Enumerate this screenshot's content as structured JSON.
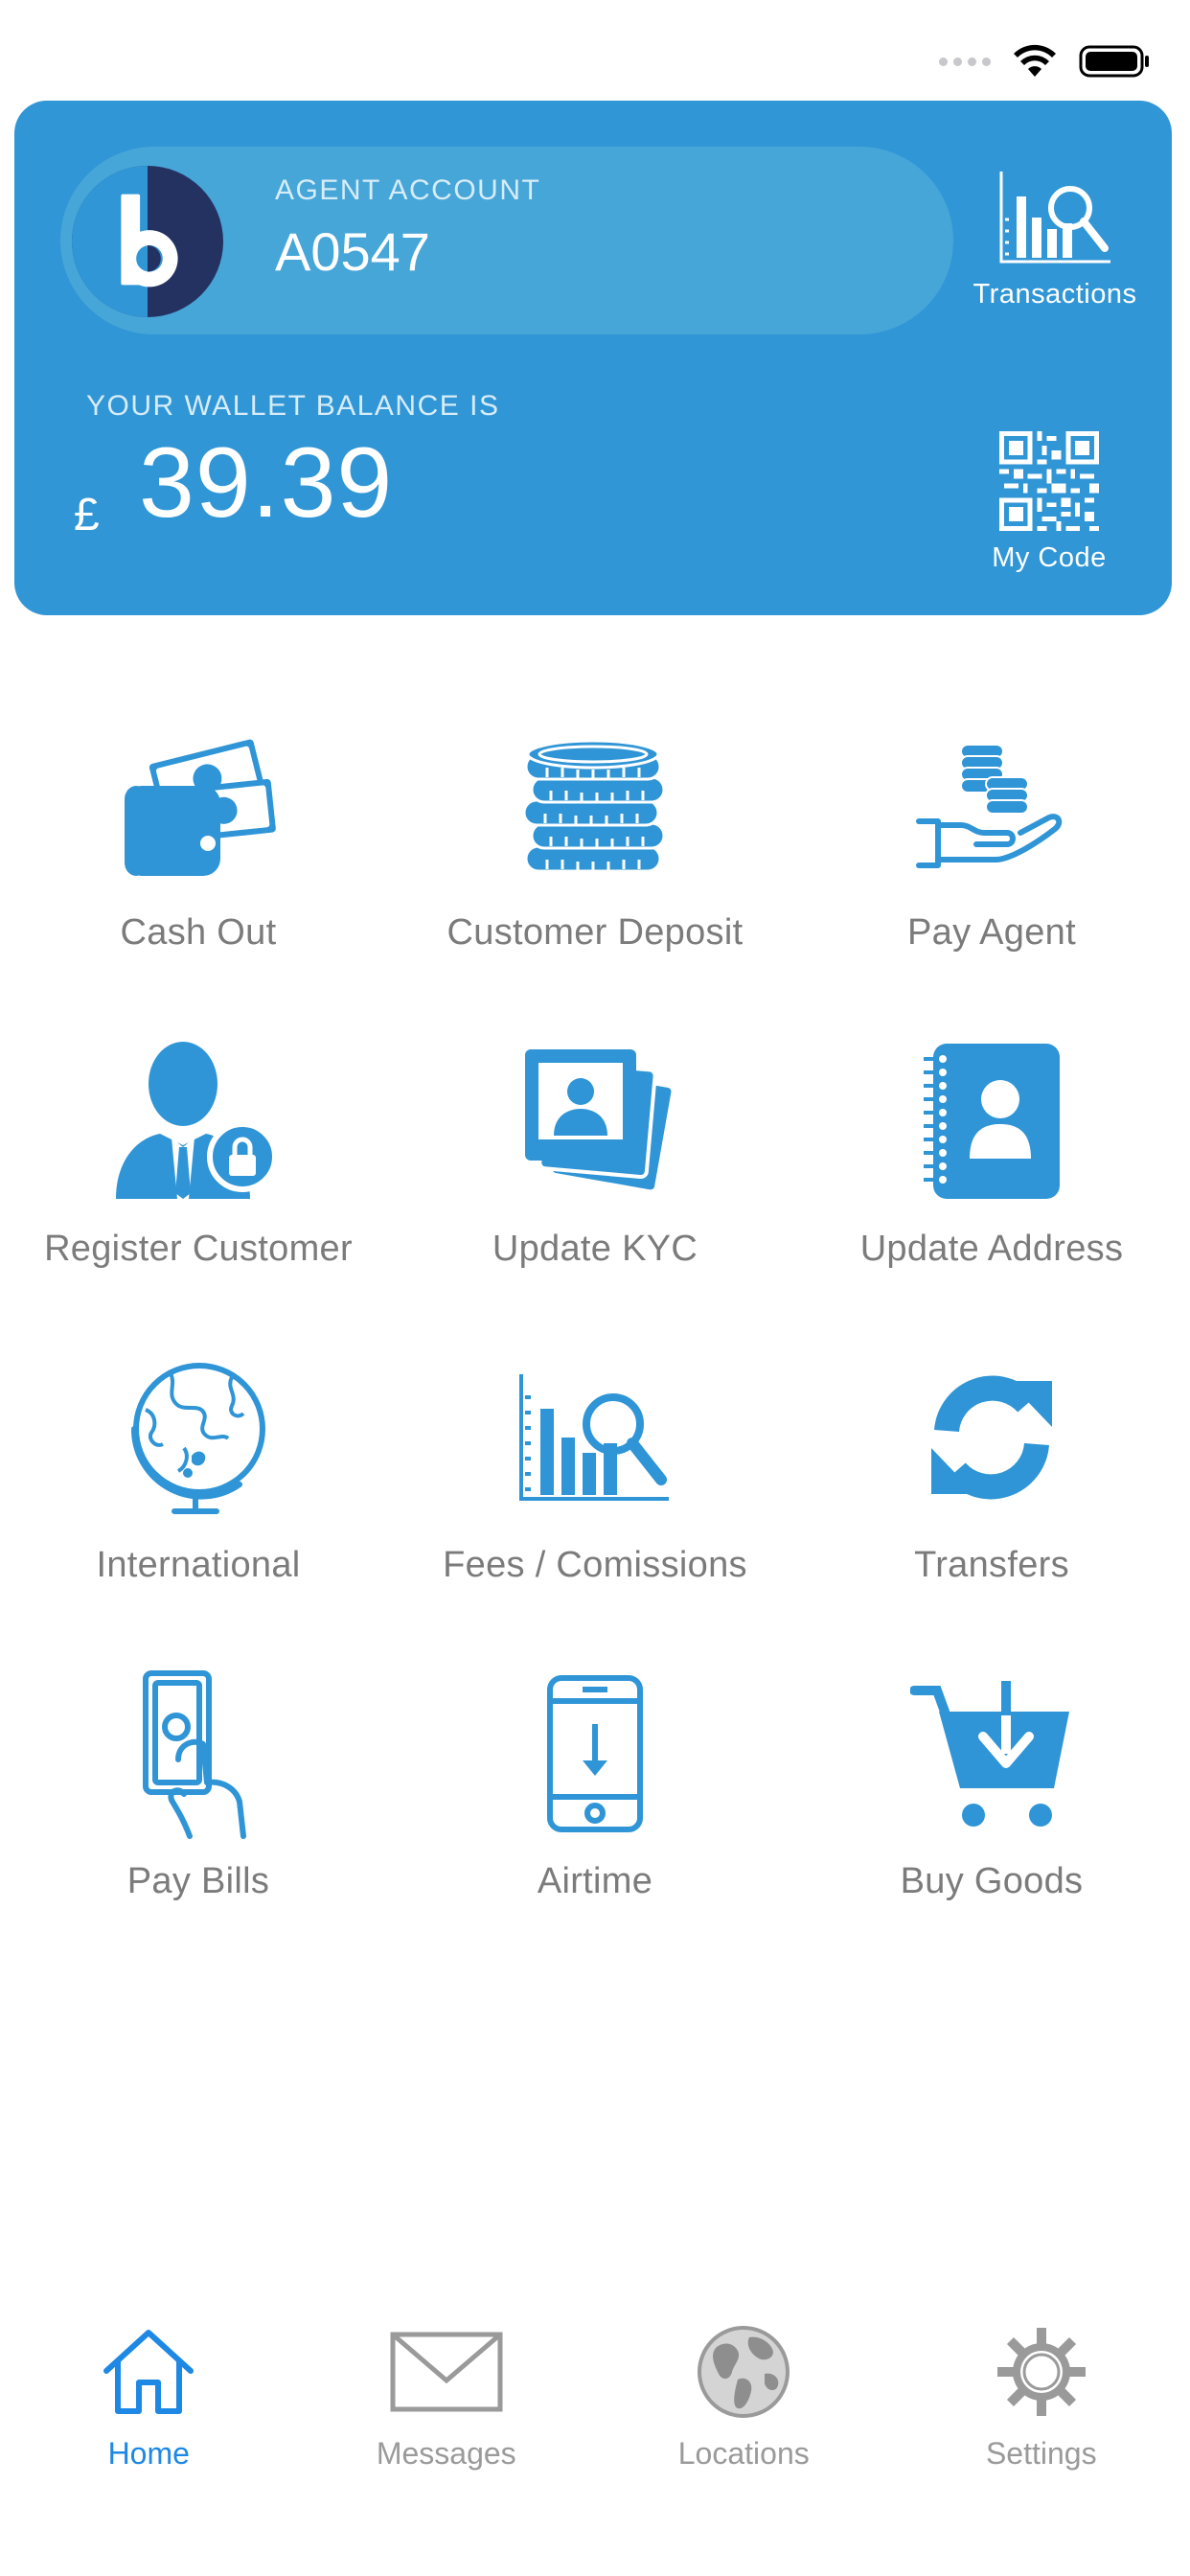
{
  "theme": {
    "primary": "#3096d6",
    "icon_blue": "#2f95d6",
    "active_tab": "#1e88e5",
    "inactive_tab": "#9a9a9a",
    "label_gray": "#7b7b7b"
  },
  "status_bar": {
    "icons": [
      "signal-dots-icon",
      "wifi-icon",
      "battery-icon"
    ]
  },
  "account_card": {
    "account_label": "AGENT ACCOUNT",
    "account_number": "A0547",
    "balance_label": "YOUR WALLET BALANCE IS",
    "currency_symbol": "£",
    "balance": "39.39",
    "transactions_label": "Transactions",
    "my_code_label": "My Code"
  },
  "services": [
    {
      "label": "Cash Out",
      "icon": "wallet-cash-icon"
    },
    {
      "label": "Customer Deposit",
      "icon": "coin-stack-icon"
    },
    {
      "label": "Pay Agent",
      "icon": "hand-coins-icon"
    },
    {
      "label": "Register Customer",
      "icon": "user-lock-icon"
    },
    {
      "label": "Update KYC",
      "icon": "photo-id-icon"
    },
    {
      "label": "Update Address",
      "icon": "address-book-icon"
    },
    {
      "label": "International",
      "icon": "globe-icon"
    },
    {
      "label": "Fees / Comissions",
      "icon": "chart-search-icon"
    },
    {
      "label": "Transfers",
      "icon": "refresh-arrows-icon"
    },
    {
      "label": "Pay Bills",
      "icon": "hand-bill-icon"
    },
    {
      "label": "Airtime",
      "icon": "phone-download-icon"
    },
    {
      "label": "Buy Goods",
      "icon": "cart-download-icon"
    }
  ],
  "tab_bar": {
    "tabs": [
      {
        "label": "Home",
        "icon": "home-icon",
        "active": true
      },
      {
        "label": "Messages",
        "icon": "envelope-icon",
        "active": false
      },
      {
        "label": "Locations",
        "icon": "globe-icon",
        "active": false
      },
      {
        "label": "Settings",
        "icon": "gear-icon",
        "active": false
      }
    ]
  }
}
